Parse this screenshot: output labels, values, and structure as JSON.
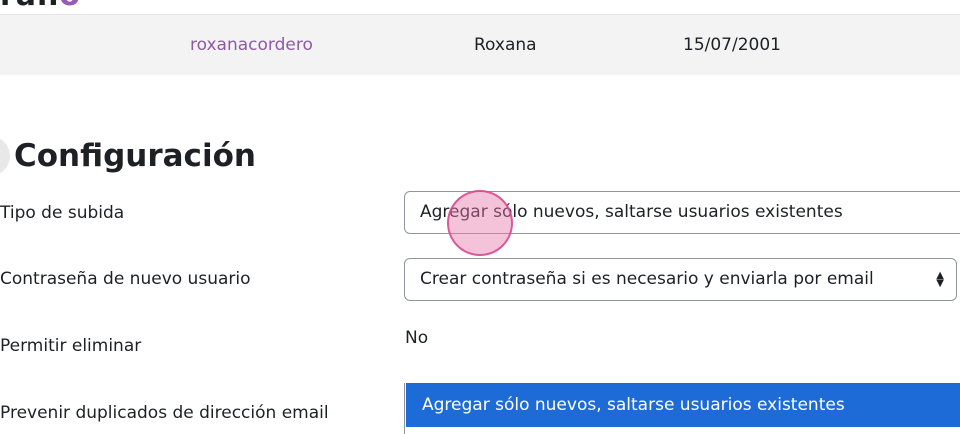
{
  "logo": {
    "text": "ran",
    "accent": "o"
  },
  "preview_row": {
    "username": "roxanacordero",
    "firstname": "Roxana",
    "date": "15/07/2001"
  },
  "section": {
    "title": "Configuración"
  },
  "form": {
    "upload_type": {
      "label": "Tipo de subida",
      "value": "Agregar sólo nuevos, saltarse usuarios existentes"
    },
    "new_user_password": {
      "label": "Contraseña de nuevo usuario",
      "value": "Crear contraseña si es necesario y enviarla por email"
    },
    "allow_delete": {
      "label": "Permitir eliminar",
      "value": "No"
    },
    "prevent_email_duplicates": {
      "label": "Prevenir duplicados de dirección email"
    }
  },
  "dropdown": {
    "highlighted_option": "Agregar sólo nuevos, saltarse usuarios existentes"
  },
  "colors": {
    "link_purple": "#8f59a8",
    "highlight_blue": "#1d6bd6",
    "click_marker": "#e678aa"
  }
}
